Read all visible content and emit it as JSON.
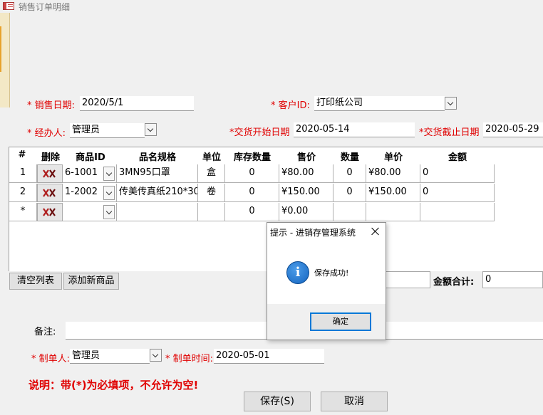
{
  "window": {
    "title": "销售订单明细"
  },
  "form": {
    "sale_date_label": "* 销售日期:",
    "sale_date": "2020/5/1",
    "customer_label": "* 客户ID:",
    "customer": "打印纸公司",
    "handler_label": "* 经办人:",
    "handler": "管理员",
    "delivery_start_label": "*交货开始日期",
    "delivery_start": "2020-05-14",
    "delivery_end_label": "*交货截止日期",
    "delivery_end": "2020-05-29"
  },
  "grid": {
    "headers": [
      "#",
      "删除",
      "商品ID",
      "品名规格",
      "单位",
      "库存数量",
      "售价",
      "数量",
      "单价",
      "金额"
    ],
    "rows": [
      {
        "num": "1",
        "product_id": "6-1001",
        "name": "3MN95口罩",
        "unit": "盒",
        "stock": "0",
        "sale_price": "¥80.00",
        "qty": "0",
        "unit_price": "¥80.00",
        "amount": "0"
      },
      {
        "num": "2",
        "product_id": "1-2002",
        "name": "传美传真纸210*30",
        "unit": "卷",
        "stock": "0",
        "sale_price": "¥150.00",
        "qty": "0",
        "unit_price": "¥150.00",
        "amount": "0"
      },
      {
        "num": "*",
        "product_id": "",
        "name": "",
        "unit": "",
        "stock": "0",
        "sale_price": "¥0.00",
        "qty": "",
        "unit_price": "",
        "amount": ""
      }
    ]
  },
  "actions": {
    "clear_list": "清空列表",
    "add_product": "添加新商品",
    "total_label": "金额合计:",
    "total_value": "0"
  },
  "footer": {
    "remark_label": "备注:",
    "maker_label": "* 制单人:",
    "maker": "管理员",
    "make_time_label": "* 制单时间:",
    "make_time": "2020-05-01",
    "note": "说明：带(*)为必填项，不允许为空!",
    "save": "保存(S)",
    "cancel": "取消"
  },
  "dialog": {
    "title": "提示 - 进销存管理系统",
    "message": "保存成功!",
    "icon": "i",
    "ok": "确定"
  },
  "colors": {
    "required": "#e00000",
    "dialog_focus": "#0078d7",
    "info_icon": "#1565c0"
  }
}
